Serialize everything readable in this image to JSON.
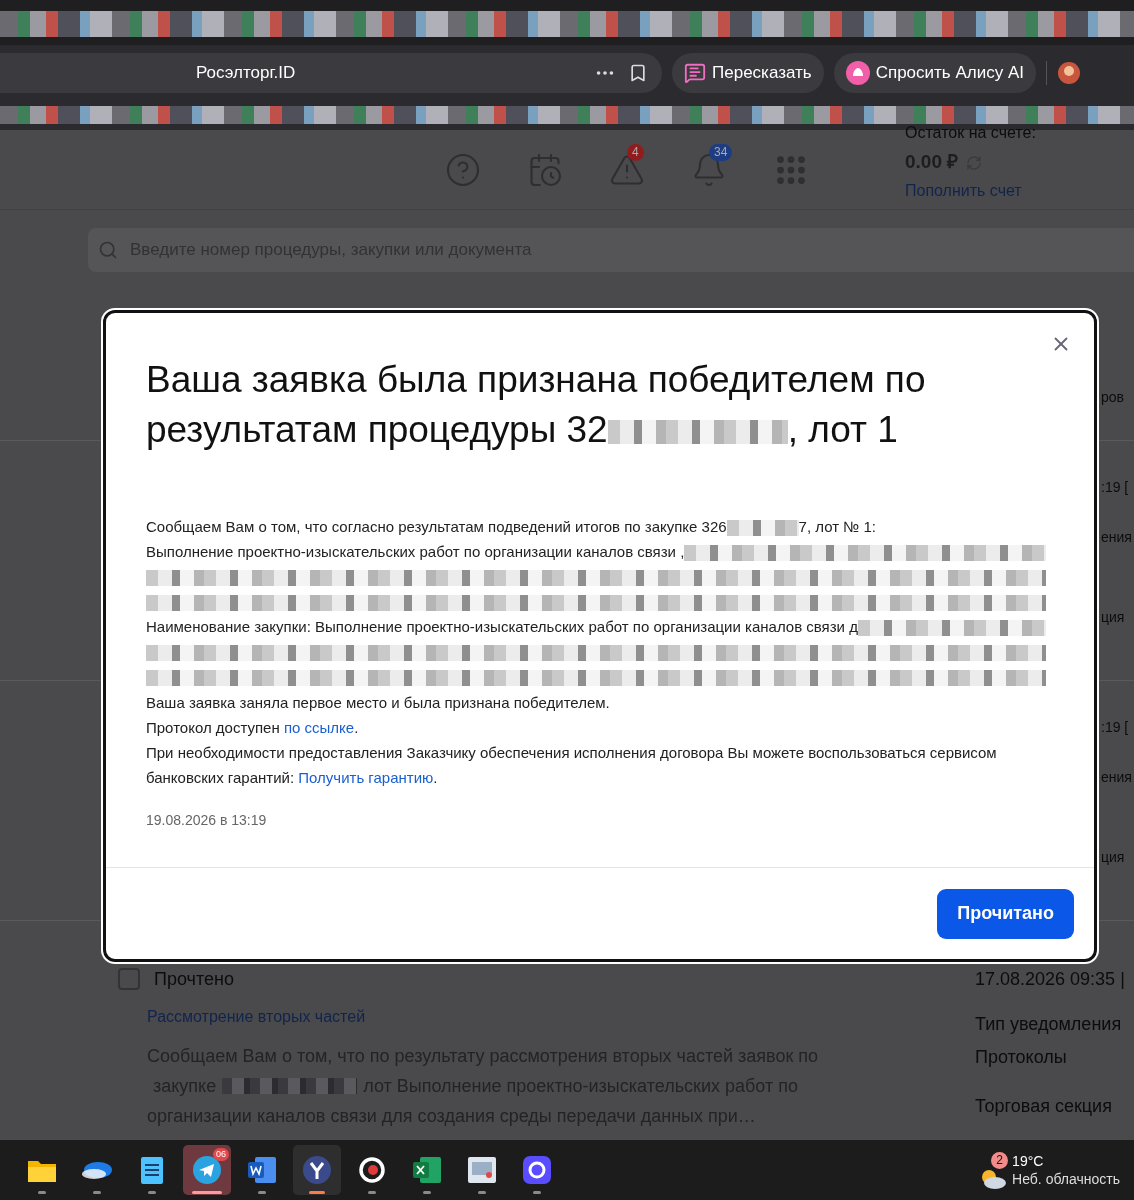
{
  "browser": {
    "site_title": "Росэлторг.ID",
    "actions": [
      {
        "kind": "retell",
        "label": "Пересказать"
      },
      {
        "kind": "alice",
        "label": "Спросить Алису AI"
      }
    ]
  },
  "header": {
    "icons": [
      {
        "kind": "help"
      },
      {
        "kind": "calendar"
      },
      {
        "kind": "alert",
        "badge": "4",
        "color": "#8f1d1d"
      },
      {
        "kind": "bell",
        "badge": "34",
        "color": "#1d3c82"
      },
      {
        "kind": "apps"
      }
    ],
    "balance_label": "Остаток на счете:",
    "balance": "0.00 ₽",
    "top_up_link": "Пополнить счет"
  },
  "search": {
    "placeholder": "Введите номер процедуры, закупки или документа"
  },
  "status_fragment": "ров",
  "background_rows": [
    {
      "date_fragment": ":19 [",
      "type_fragment": "ения",
      "section_fragment": "ция"
    },
    {
      "date_fragment": ":19 [",
      "type_fragment": "ения",
      "section_fragment": "ция"
    }
  ],
  "notification": {
    "status": "Прочтено",
    "read": false,
    "date": "17.08.2026 09:35 |",
    "title": "Рассмотрение вторых частей",
    "lines": [
      [
        {
          "kind": "text",
          "text": "Сообщаем Вам о том, что по результату рассмотрения вторых частей заявок по"
        }
      ],
      [
        {
          "kind": "text",
          "text": "закупке"
        },
        {
          "kind": "redacted"
        },
        {
          "kind": "text",
          "text": "лот Выполнение проектно-изыскательских работ по"
        }
      ],
      [
        {
          "kind": "text",
          "text": "организации каналов связи для создания среды передачи данных при…"
        }
      ]
    ],
    "type_label": "Тип уведомления",
    "type": "Протоколы",
    "section_label": "Торговая секция"
  },
  "modal": {
    "title": [
      {
        "kind": "text",
        "text": "Ваша заявка была признана победителем по результатам процедуры 32"
      },
      {
        "kind": "redacted"
      },
      {
        "kind": "text",
        "text": ", лот 1"
      }
    ],
    "lines": [
      [
        {
          "kind": "text",
          "text": "Сообщаем Вам о том, что согласно результатам подведений итогов по закупке 326"
        },
        {
          "kind": "redacted"
        },
        {
          "kind": "text",
          "text": "7, лот № 1:"
        }
      ],
      [
        {
          "kind": "text",
          "text": "Выполнение проектно-изыскательских работ по организации каналов связи ,"
        },
        {
          "kind": "redacted"
        }
      ],
      [
        {
          "kind": "redacted"
        }
      ],
      [
        {
          "kind": "redacted"
        }
      ],
      [
        {
          "kind": "text",
          "text": "Наименование закупки: Выполнение проектно-изыскательских работ по организации каналов связи д"
        },
        {
          "kind": "redacted"
        }
      ],
      [
        {
          "kind": "redacted"
        }
      ],
      [
        {
          "kind": "redacted"
        }
      ],
      [
        {
          "kind": "text",
          "text": "Ваша заявка заняла первое место и была признана победителем."
        }
      ],
      [
        {
          "kind": "text",
          "text": "Протокол доступен "
        },
        {
          "kind": "link",
          "text": "по ссылке"
        },
        {
          "kind": "text",
          "text": "."
        }
      ],
      [
        {
          "kind": "text",
          "text": "При необходимости предоставления Заказчику обеспечения исполнения договора Вы можете воспользоваться сервисом банковских гарантий: "
        },
        {
          "kind": "link",
          "text": "Получить гарантию"
        },
        {
          "kind": "text",
          "text": "."
        }
      ]
    ],
    "date": "19.08.2026 в 13:19",
    "button": "Прочитано"
  },
  "taskbar": {
    "apps": [
      {
        "kind": "folder",
        "selected": false,
        "attention": false
      },
      {
        "kind": "cloud",
        "selected": false,
        "attention": false
      },
      {
        "kind": "notepad",
        "selected": false,
        "attention": false
      },
      {
        "kind": "messenger",
        "selected": false,
        "attention": true,
        "badge": "06"
      },
      {
        "kind": "word",
        "selected": false,
        "attention": false
      },
      {
        "kind": "browser",
        "selected": true,
        "attention": false
      },
      {
        "kind": "target",
        "selected": false,
        "attention": false
      },
      {
        "kind": "excel",
        "selected": false,
        "attention": false
      },
      {
        "kind": "remote",
        "selected": false,
        "attention": false
      },
      {
        "kind": "chat",
        "selected": false,
        "attention": false
      }
    ],
    "weather": {
      "badge": "2",
      "temperature": "19°C",
      "condition": "Неб. облачность"
    }
  }
}
